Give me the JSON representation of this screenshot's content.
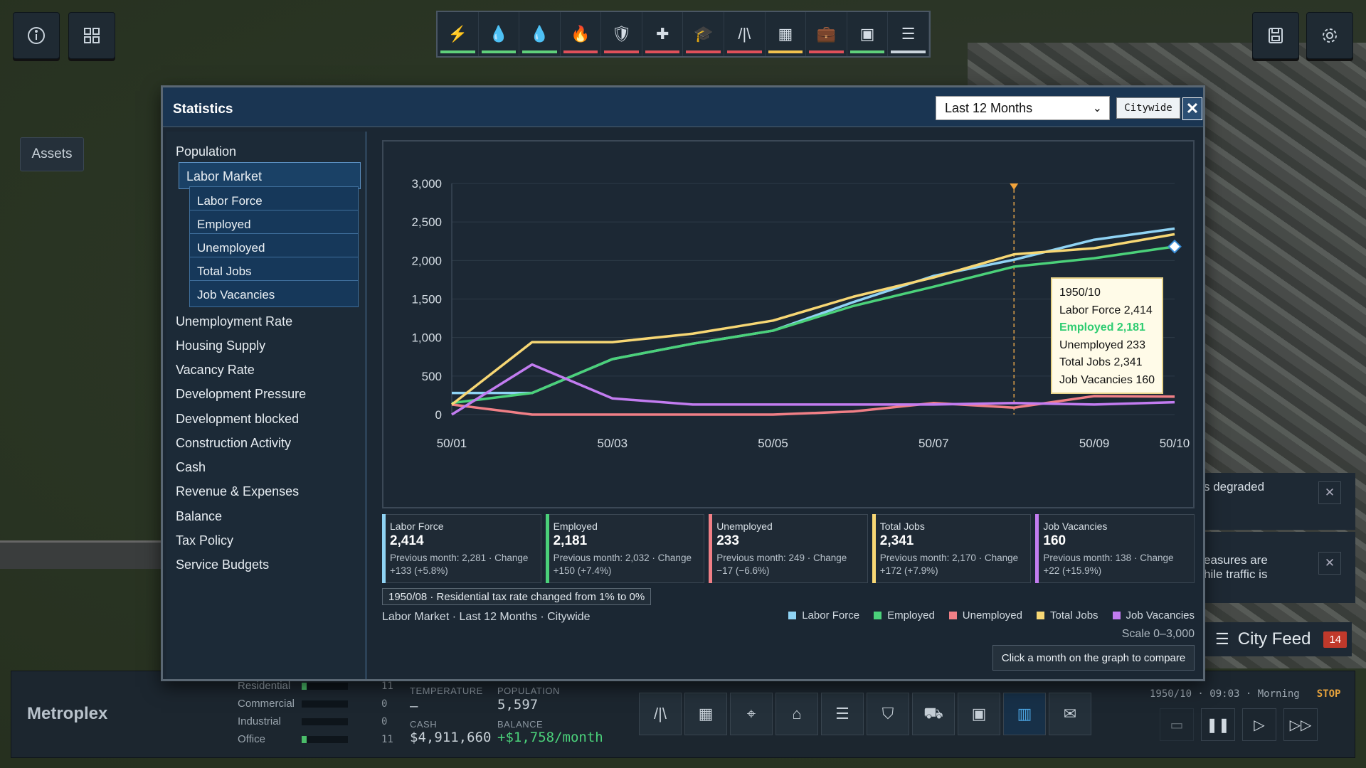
{
  "top_left": {
    "info_icon": "info-icon",
    "dashboard_icon": "grid-icon"
  },
  "toolbar": {
    "tools": [
      {
        "name": "power",
        "glyph": "⚡",
        "status": "#5fd07b"
      },
      {
        "name": "water",
        "glyph": "💧",
        "status": "#5fd07b"
      },
      {
        "name": "sewage",
        "glyph": "💧",
        "status": "#5fd07b"
      },
      {
        "name": "fire",
        "glyph": "🔥",
        "status": "#e0505a"
      },
      {
        "name": "police",
        "glyph": "🛡",
        "status": "#e0505a"
      },
      {
        "name": "health",
        "glyph": "✚",
        "status": "#e0505a"
      },
      {
        "name": "education",
        "glyph": "🎓",
        "status": "#e0505a"
      },
      {
        "name": "roads",
        "glyph": "/|\\",
        "status": "#e0505a"
      },
      {
        "name": "zoning",
        "glyph": "▦",
        "status": "#f2c14e"
      },
      {
        "name": "jobs",
        "glyph": "💼",
        "status": "#e0505a"
      },
      {
        "name": "budget",
        "glyph": "▣",
        "status": "#5fd07b"
      },
      {
        "name": "transit",
        "glyph": "☰",
        "status": "#c9d3dc"
      }
    ]
  },
  "top_right": {
    "save_icon": "save-icon",
    "settings_icon": "gear-icon"
  },
  "assets_label": "Assets",
  "notifications": [
    {
      "text": "s degraded"
    },
    {
      "text": "easures are\nhile traffic is"
    }
  ],
  "city_feed": {
    "label": "City Feed",
    "count": "14"
  },
  "bottom": {
    "city_name": "Metroplex",
    "zones": [
      {
        "label": "Residential",
        "fill": 0.1,
        "value": "11"
      },
      {
        "label": "Commercial",
        "fill": 0,
        "value": "0"
      },
      {
        "label": "Industrial",
        "fill": 0,
        "value": "0"
      },
      {
        "label": "Office",
        "fill": 0.1,
        "value": "11"
      }
    ],
    "temperature_label": "TEMPERATURE",
    "temperature_value": "—",
    "population_label": "POPULATION",
    "population_value": "5,597",
    "cash_label": "CASH",
    "cash_value": "$4,911,660",
    "balance_label": "BALANCE",
    "balance_value": "+$1,758/month",
    "datetime": "1950/10 · 09:03 · Morning",
    "stop_label": "STOP"
  },
  "stats": {
    "title": "Statistics",
    "period": "Last 12 Months",
    "scope": "Citywide",
    "close": "✕",
    "nav": [
      {
        "label": "Population"
      },
      {
        "label": "Labor Market"
      },
      {
        "label": "Unemployment Rate"
      },
      {
        "label": "Housing Supply"
      },
      {
        "label": "Vacancy Rate"
      },
      {
        "label": "Development Pressure"
      },
      {
        "label": "Development blocked"
      },
      {
        "label": "Construction Activity"
      },
      {
        "label": "Cash"
      },
      {
        "label": "Revenue & Expenses"
      },
      {
        "label": "Balance"
      },
      {
        "label": "Tax Policy"
      },
      {
        "label": "Service Budgets"
      }
    ],
    "subnav": [
      "Labor Force",
      "Employed",
      "Unemployed",
      "Total Jobs",
      "Job Vacancies"
    ],
    "cards": [
      {
        "label": "Labor Force",
        "value": "2,414",
        "prev": "Previous month: 2,281 · Change",
        "change": "+133 (+5.8%)",
        "color": "#8fd3f4"
      },
      {
        "label": "Employed",
        "value": "2,181",
        "prev": "Previous month: 2,032 · Change",
        "change": "+150 (+7.4%)",
        "color": "#4bd17a"
      },
      {
        "label": "Unemployed",
        "value": "233",
        "prev": "Previous month: 249 · Change",
        "change": "−17 (−6.6%)",
        "color": "#f07f86"
      },
      {
        "label": "Total Jobs",
        "value": "2,341",
        "prev": "Previous month: 2,170 · Change",
        "change": "+172 (+7.9%)",
        "color": "#f7d774"
      },
      {
        "label": "Job Vacancies",
        "value": "160",
        "prev": "Previous month: 138 · Change",
        "change": "+22 (+15.9%)",
        "color": "#c27cf0"
      }
    ],
    "event": "1950/08 · Residential tax rate changed from 1% to 0%",
    "caption": "Labor Market · Last 12 Months · Citywide",
    "scale": "Scale 0–3,000",
    "hint": "Click a month on the graph to compare",
    "tooltip": {
      "title": "1950/10",
      "lines": [
        "Labor Force 2,414",
        "Employed 2,181",
        "Unemployed 233",
        "Total Jobs 2,341",
        "Job Vacancies 160"
      ]
    }
  },
  "chart_data": {
    "type": "line",
    "x": [
      "50/01",
      "50/02",
      "50/03",
      "50/04",
      "50/05",
      "50/06",
      "50/07",
      "50/08",
      "50/09",
      "50/10"
    ],
    "x_tick_labels": [
      "50/01",
      "50/03",
      "50/05",
      "50/07",
      "50/09",
      "50/10"
    ],
    "y_ticks": [
      "0",
      "500",
      "1,000",
      "1,500",
      "2,000",
      "2,500",
      "3,000"
    ],
    "ylim": [
      0,
      3000
    ],
    "marker_month": "50/08",
    "legend": [
      "Labor Force",
      "Employed",
      "Unemployed",
      "Total Jobs",
      "Job Vacancies"
    ],
    "series": [
      {
        "name": "Labor Force",
        "color": "#8fd3f4",
        "values": [
          280,
          280,
          720,
          920,
          1090,
          1460,
          1800,
          2010,
          2270,
          2414
        ]
      },
      {
        "name": "Employed",
        "color": "#4bd17a",
        "values": [
          150,
          280,
          720,
          920,
          1090,
          1410,
          1660,
          1920,
          2030,
          2181
        ]
      },
      {
        "name": "Unemployed",
        "color": "#f07f86",
        "values": [
          130,
          0,
          0,
          0,
          0,
          40,
          150,
          90,
          240,
          233
        ]
      },
      {
        "name": "Total Jobs",
        "color": "#f7d774",
        "values": [
          130,
          940,
          940,
          1050,
          1220,
          1530,
          1780,
          2080,
          2160,
          2341
        ]
      },
      {
        "name": "Job Vacancies",
        "color": "#c27cf0",
        "values": [
          0,
          650,
          210,
          130,
          130,
          130,
          130,
          150,
          130,
          160
        ]
      }
    ]
  }
}
